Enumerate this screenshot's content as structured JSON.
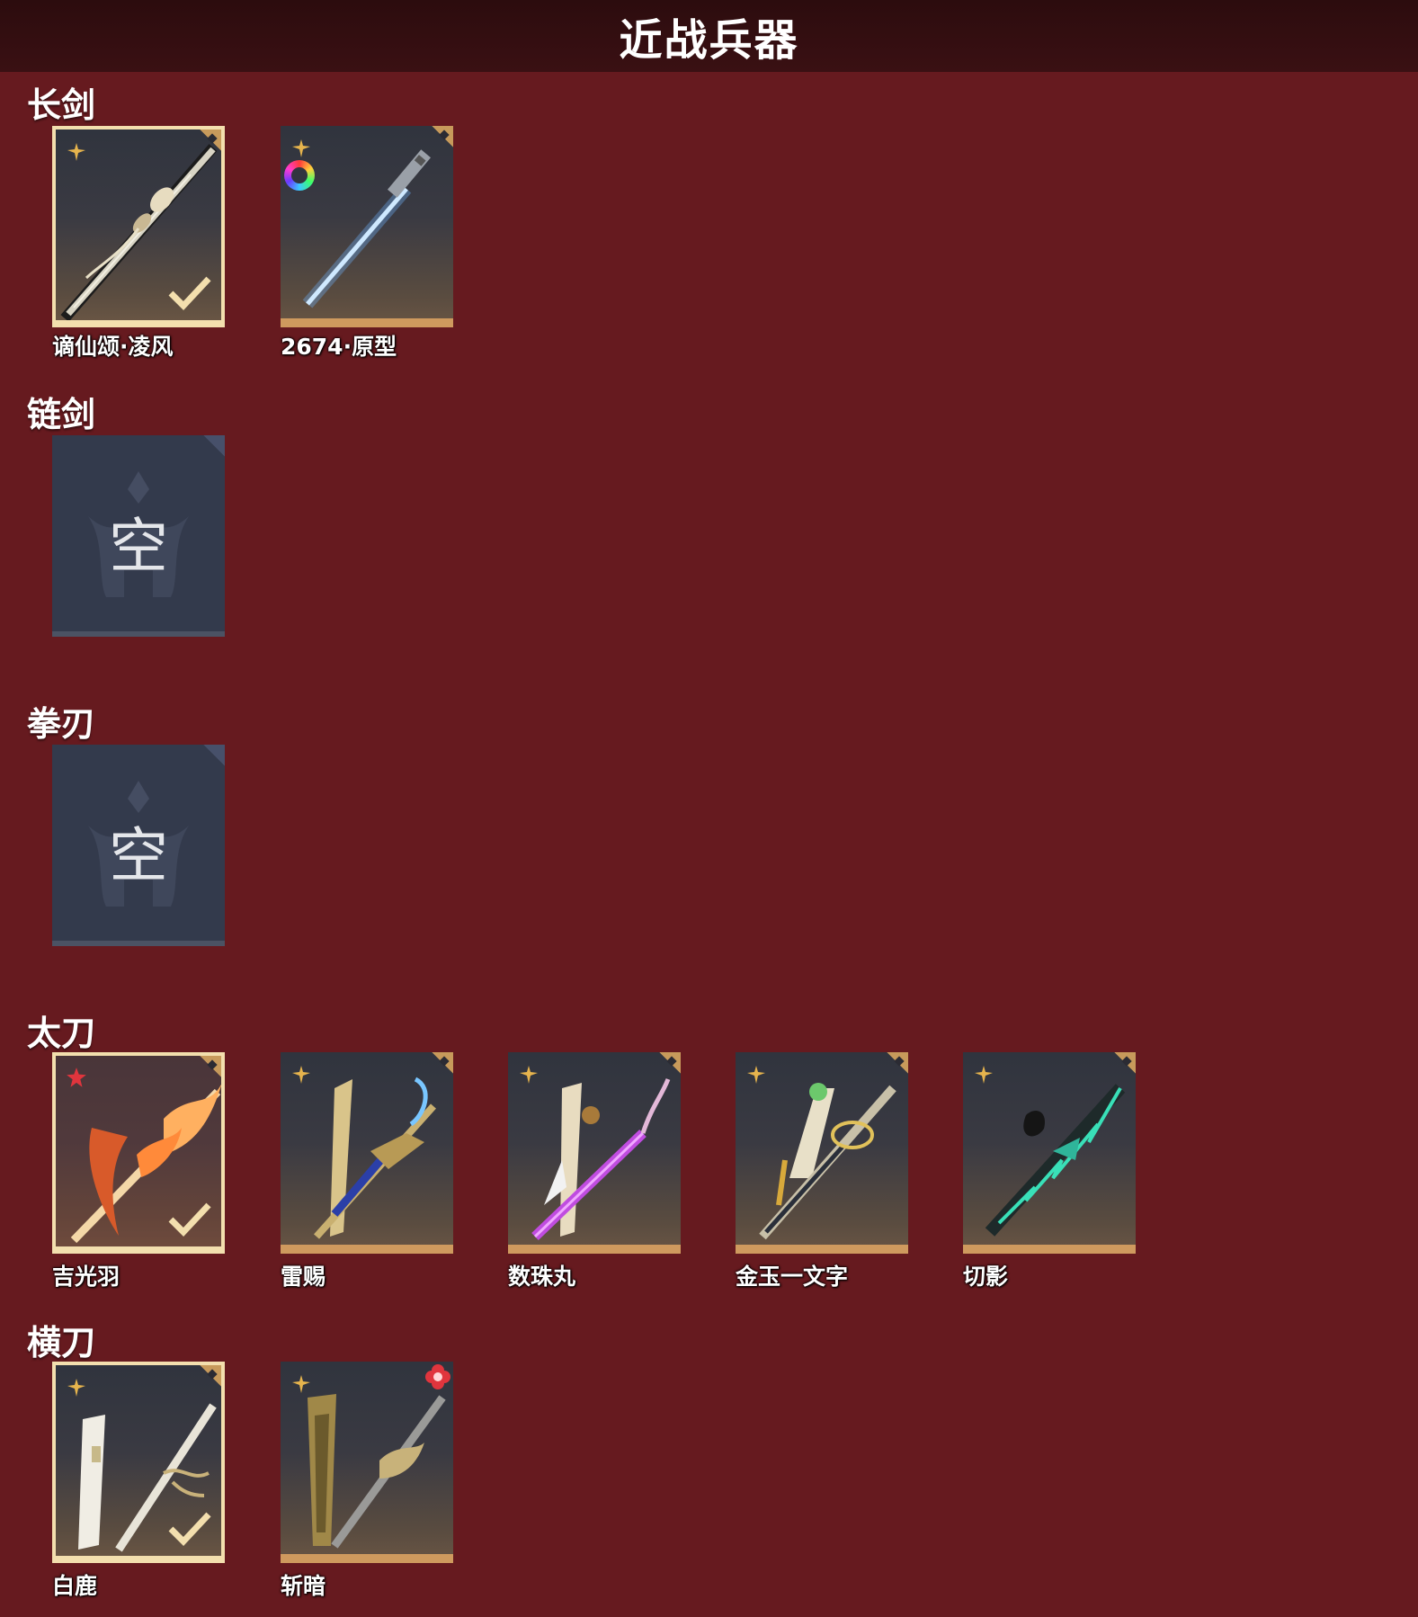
{
  "header": {
    "title": "近战兵器"
  },
  "categories": [
    {
      "title": "长剑",
      "items": [
        {
          "name": "谪仙颂·凌风",
          "selected": true,
          "badge": "gold-emblem-icon"
        },
        {
          "name": "2674·原型",
          "selected": false,
          "badge": "gold-emblem-icon",
          "extra": "rgb-ring-icon"
        }
      ]
    },
    {
      "title": "链剑",
      "items": [
        {
          "empty": true,
          "placeholder": "空"
        }
      ]
    },
    {
      "title": "拳刃",
      "items": [
        {
          "empty": true,
          "placeholder": "空"
        }
      ]
    },
    {
      "title": "太刀",
      "items": [
        {
          "name": "吉光羽",
          "selected": true,
          "badge": "red-emblem-icon"
        },
        {
          "name": "雷赐",
          "selected": false,
          "badge": "gold-emblem-icon"
        },
        {
          "name": "数珠丸",
          "selected": false,
          "badge": "gold-emblem-icon"
        },
        {
          "name": "金玉一文字",
          "selected": false,
          "badge": "gold-emblem-icon"
        },
        {
          "name": "切影",
          "selected": false,
          "badge": "gold-emblem-icon"
        }
      ]
    },
    {
      "title": "横刀",
      "items": [
        {
          "name": "白鹿",
          "selected": true,
          "badge": "gold-emblem-icon"
        },
        {
          "name": "斩暗",
          "selected": false,
          "badge": "gold-emblem-icon",
          "extra": "red-flower-icon"
        }
      ]
    }
  ],
  "colors": {
    "background": "#661a1f",
    "header_bg": "#2c0c0e",
    "card_footer": "#cf9a5e",
    "selected_border": "#f3dfae",
    "empty_card": "#333a4c"
  }
}
